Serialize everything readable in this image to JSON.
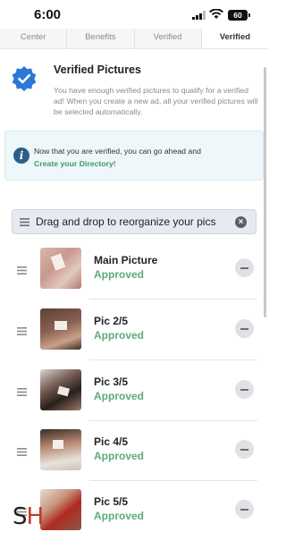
{
  "status_bar": {
    "time": "6:00",
    "battery": "60"
  },
  "tabs": [
    {
      "label": "Center",
      "active": false
    },
    {
      "label": "Benefits",
      "active": false
    },
    {
      "label": "Verified",
      "active": false
    },
    {
      "label": "Verified",
      "active": true
    }
  ],
  "verified": {
    "title": "Verified Pictures",
    "description": "You have enough verified pictures to qualify for a verified ad! When you create a new ad, all your verified pictures will be selected automatically."
  },
  "info": {
    "text": "Now that you are verified, you can go ahead and",
    "link": "Create your Directory",
    "suffix": "!"
  },
  "drag": {
    "label": "Drag and drop to reorganize your pics"
  },
  "pictures": [
    {
      "name": "Main Picture",
      "status": "Approved"
    },
    {
      "name": "Pic 2/5",
      "status": "Approved"
    },
    {
      "name": "Pic 3/5",
      "status": "Approved"
    },
    {
      "name": "Pic 4/5",
      "status": "Approved"
    },
    {
      "name": "Pic 5/5",
      "status": "Approved"
    }
  ],
  "watermark": {
    "left": "S",
    "right": "H"
  },
  "colors": {
    "accent_green": "#5cab7d",
    "badge_blue": "#2b78d6",
    "info_blue": "#2b5f86"
  }
}
